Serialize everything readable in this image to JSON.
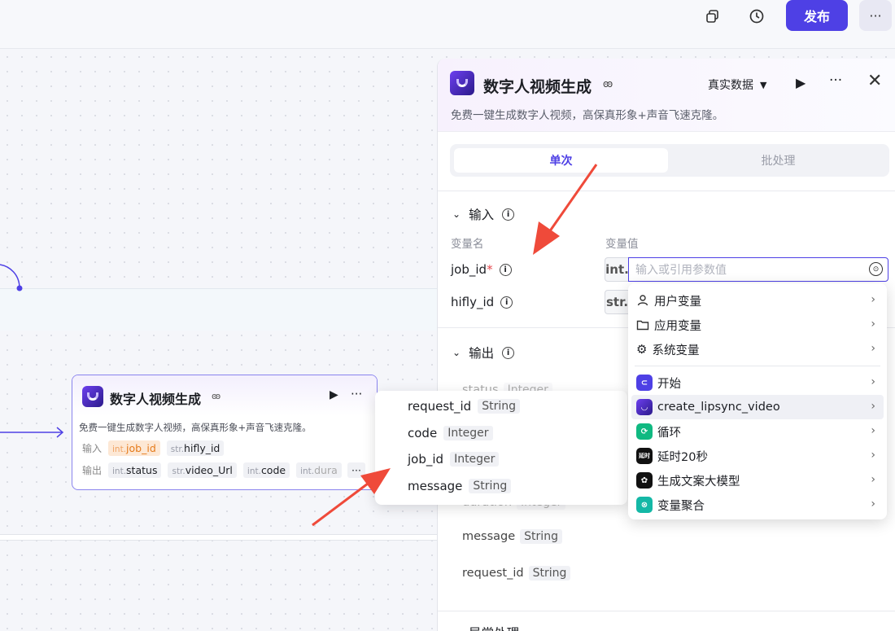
{
  "topbar": {
    "publish_label": "发布",
    "more_label": "···"
  },
  "canvas_node": {
    "title": "数字人视频生成",
    "description": "免费一键生成数字人视频，高保真形象+声音飞速克隆。",
    "input_label": "输入",
    "output_label": "输出",
    "inputs": [
      {
        "type": "int.",
        "name": "job_id"
      },
      {
        "type": "str.",
        "name": "hifly_id"
      }
    ],
    "outputs": [
      {
        "type": "int.",
        "name": "status"
      },
      {
        "type": "str.",
        "name": "video_Url"
      },
      {
        "type": "int.",
        "name": "code"
      },
      {
        "type": "int.",
        "name": "dura"
      }
    ],
    "more_label": "···"
  },
  "panel": {
    "title": "数字人视频生成",
    "description": "免费一键生成数字人视频，高保真形象+声音飞速克隆。",
    "data_mode": "真实数据",
    "tabs": {
      "single": "单次",
      "batch": "批处理"
    },
    "input_section": {
      "title": "输入",
      "col_name": "变量名",
      "col_value": "变量值",
      "vars": [
        {
          "name": "job_id",
          "required_mark": "*",
          "type": "int."
        },
        {
          "name": "hifly_id",
          "type": "str."
        }
      ],
      "value_placeholder": "输入或引用参数值"
    },
    "output_section": {
      "title": "输出",
      "items": [
        {
          "name": "status",
          "type": "Integer"
        },
        {
          "name": "duration",
          "type": "Integer"
        },
        {
          "name": "message",
          "type": "String"
        },
        {
          "name": "request_id",
          "type": "String"
        }
      ]
    },
    "bottom_section": {
      "title": "异常处理"
    }
  },
  "fields_popup": [
    {
      "name": "request_id",
      "type": "String"
    },
    {
      "name": "code",
      "type": "Integer"
    },
    {
      "name": "job_id",
      "type": "Integer"
    },
    {
      "name": "message",
      "type": "String"
    }
  ],
  "dropdown": {
    "groups": [
      {
        "label": "用户变量",
        "icon": "user-icon"
      },
      {
        "label": "应用变量",
        "icon": "folder-icon"
      },
      {
        "label": "系统变量",
        "icon": "gear-icon"
      }
    ],
    "nodes": [
      {
        "label": "开始",
        "icon": "start-node-icon",
        "color": "#4e40e5"
      },
      {
        "label": "create_lipsync_video",
        "icon": "plugin-node-icon",
        "color": "#5b2fd6"
      },
      {
        "label": "循环",
        "icon": "loop-node-icon",
        "color": "#10b981"
      },
      {
        "label": "延时20秒",
        "icon": "delay-node-icon",
        "color": "#111111",
        "icon_text": "延时"
      },
      {
        "label": "生成文案大模型",
        "icon": "llm-node-icon",
        "color": "#111111"
      },
      {
        "label": "变量聚合",
        "icon": "aggregate-node-icon",
        "color": "#14b8a6"
      }
    ]
  },
  "colors": {
    "accent": "#4e40e5",
    "node_border": "#8a84ee",
    "warn_chip": "#e57a1a",
    "annotation_arrow": "#ef4a3a"
  }
}
